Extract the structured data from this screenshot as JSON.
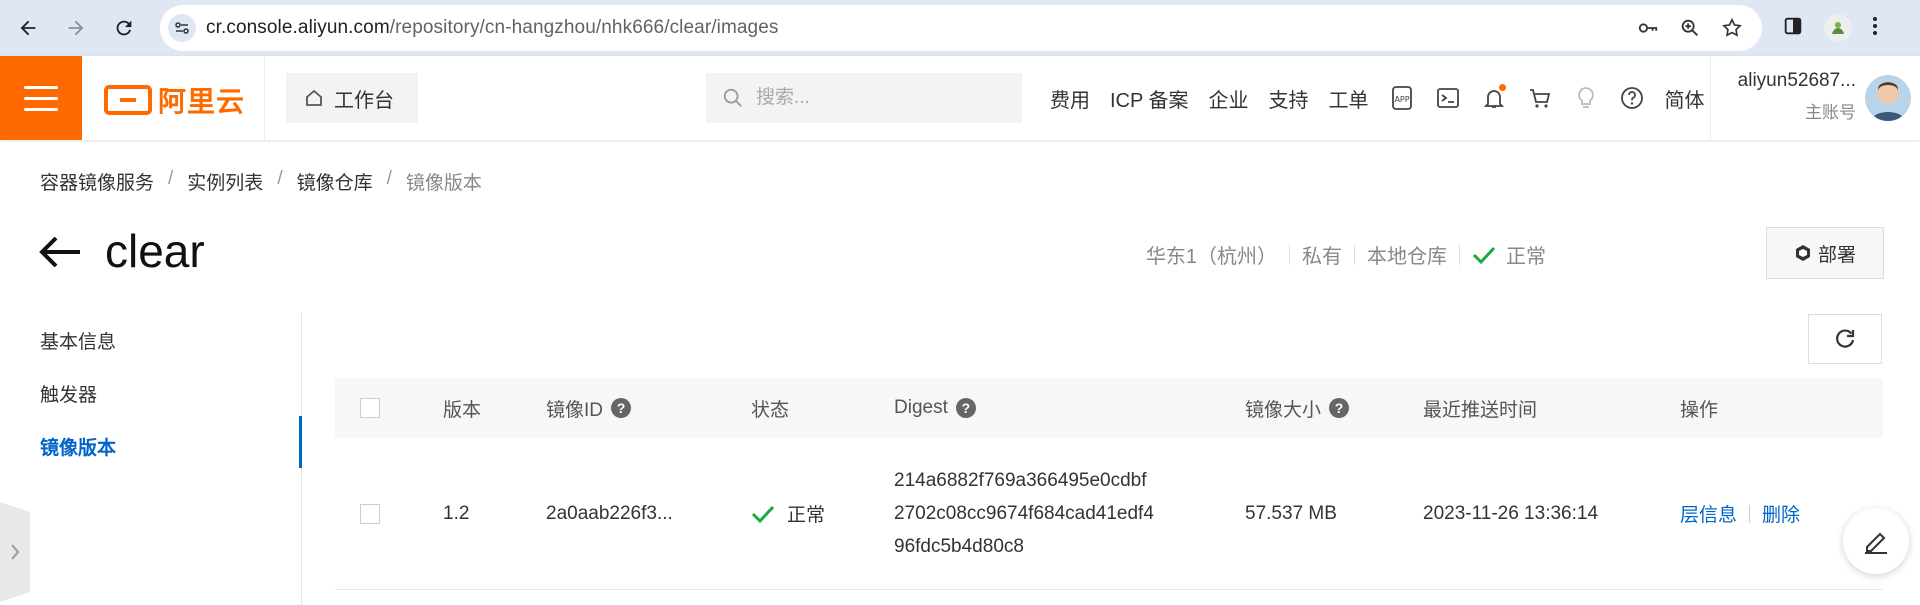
{
  "browser": {
    "url_host": "cr.console.aliyun.com",
    "url_path": "/repository/cn-hangzhou/nhk666/clear/images"
  },
  "topnav": {
    "logo_text": "阿里云",
    "workbench_label": "工作台",
    "search_placeholder": "搜索...",
    "menu": {
      "fees": "费用",
      "icp": "ICP 备案",
      "enterprise": "企业",
      "support": "支持",
      "ticket": "工单",
      "lang": "简体"
    },
    "account_name": "aliyun52687...",
    "account_role": "主账号",
    "notification_dot_color": "#ff6a00"
  },
  "breadcrumb": [
    "容器镜像服务",
    "实例列表",
    "镜像仓库",
    "镜像版本"
  ],
  "page": {
    "title": "clear",
    "region": "华东1（杭州）",
    "visibility": "私有",
    "repo_type": "本地仓库",
    "status": "正常",
    "deploy_label": "部署"
  },
  "sidenav": {
    "items": [
      "基本信息",
      "触发器",
      "镜像版本"
    ],
    "active": "镜像版本"
  },
  "table": {
    "headers": {
      "version": "版本",
      "image_id": "镜像ID",
      "status": "状态",
      "digest": "Digest",
      "size": "镜像大小",
      "pushed": "最近推送时间",
      "actions": "操作"
    },
    "rows": [
      {
        "version": "1.2",
        "image_id": "2a0aab226f3...",
        "status": "正常",
        "digest_1": "214a6882f769a366495e0cdbf",
        "digest_2": "2702c08cc9674f684cad41edf4",
        "digest_3": "96fdc5b4d80c8",
        "size": "57.537 MB",
        "pushed": "2023-11-26 13:36:14",
        "action_layers": "层信息",
        "action_delete": "删除"
      }
    ]
  },
  "colors": {
    "brand": "#ff6a00",
    "link": "#0064c8",
    "ok": "#1aab3c"
  }
}
